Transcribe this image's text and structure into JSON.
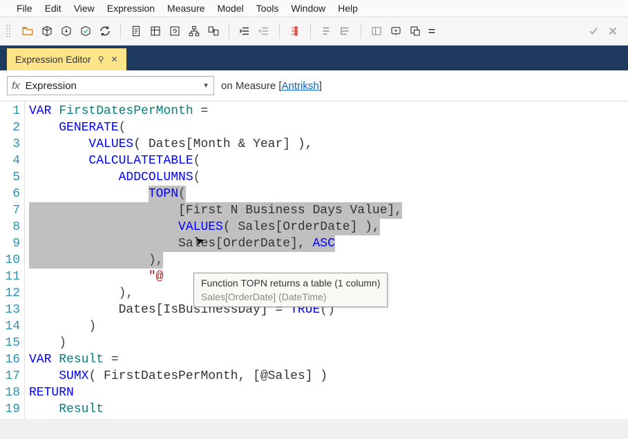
{
  "menu": [
    "File",
    "Edit",
    "View",
    "Expression",
    "Measure",
    "Model",
    "Tools",
    "Window",
    "Help"
  ],
  "toolbar_icons": [
    "folder-open-icon",
    "cube-in-icon",
    "cube-down-icon",
    "cube-check-icon",
    "refresh-icon",
    "sep",
    "document-icon",
    "page-columns-icon",
    "page-refresh-icon",
    "hierarchy-icon",
    "page-connect-icon",
    "sep",
    "indent-icon",
    "outdent-icon",
    "sep",
    "code-tree-icon",
    "sep",
    "uncomment-icon",
    "comment-icon",
    "sep",
    "prev-panel-icon",
    "tooltip-box-icon",
    "page-popup-icon",
    "small-bars-icon",
    "check-icon",
    "close-x-icon"
  ],
  "tab": {
    "title": "Expression Editor",
    "pin": "⚲",
    "close": "✕"
  },
  "context": {
    "fx": "fx",
    "dropdown": "Expression",
    "label_prefix": "on Measure [",
    "measure": "Antriksh",
    "label_suffix": "]"
  },
  "lines": {
    "count": 19,
    "l1": {
      "var": "VAR",
      "id": "FirstDatesPerMonth",
      "eq": " ="
    },
    "l2": {
      "fn": "GENERATE",
      "p": "("
    },
    "l3": {
      "fn": "VALUES",
      "txt": "( Dates[Month & Year] ),"
    },
    "l4": {
      "fn": "CALCULATETABLE",
      "p": "("
    },
    "l5": {
      "fn": "ADDCOLUMNS",
      "p": "("
    },
    "l6": {
      "fn": "TOPN",
      "p": "("
    },
    "l7": {
      "txt": "[First N Business Days Value],"
    },
    "l8": {
      "fn": "VALUES",
      "txt": "( Sales[OrderDate] ),"
    },
    "l9": {
      "txt": "Sales[OrderDate], ",
      "asc": "ASC"
    },
    "l10": {
      "txt": "),"
    },
    "l11": {
      "str": "\"@"
    },
    "l12": {
      "txt": "),"
    },
    "l13": {
      "txt": "Dates[IsBusinessDay] = ",
      "fn": "TRUE",
      "p": "()"
    },
    "l14": {
      "txt": ")"
    },
    "l15": {
      "txt": ")"
    },
    "l16": {
      "var": "VAR",
      "id": "Result",
      "eq": " ="
    },
    "l17": {
      "fn": "SUMX",
      "txt": "( FirstDatesPerMonth, [@Sales] )"
    },
    "l18": {
      "ret": "RETURN"
    },
    "l19": {
      "id": "Result"
    }
  },
  "tooltip": {
    "line1": "Function TOPN returns a table (1 column)",
    "line2": "Sales[OrderDate] (DateTime)"
  }
}
